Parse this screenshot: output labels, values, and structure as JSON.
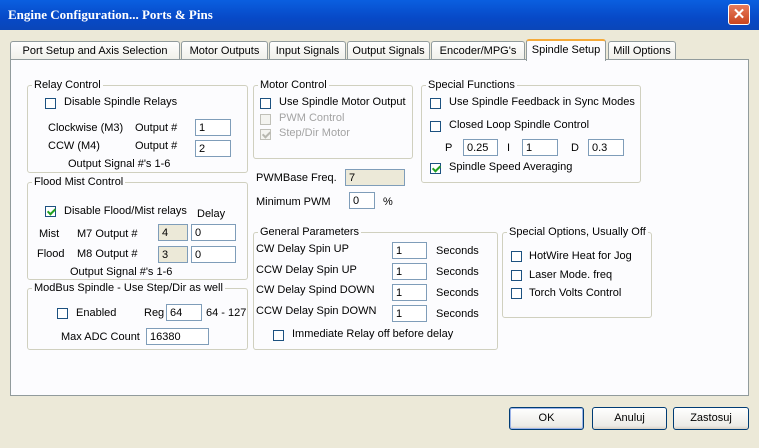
{
  "window": {
    "title": "Engine Configuration... Ports & Pins",
    "close": "✕"
  },
  "tabs": [
    {
      "label": "Port Setup and Axis Selection"
    },
    {
      "label": "Motor Outputs"
    },
    {
      "label": "Input Signals"
    },
    {
      "label": "Output Signals"
    },
    {
      "label": "Encoder/MPG's"
    },
    {
      "label": "Spindle Setup"
    },
    {
      "label": "Mill Options"
    }
  ],
  "relay": {
    "title": "Relay Control",
    "disable_label": "Disable Spindle Relays",
    "cw_label": "Clockwise (M3)",
    "ccw_label": "CCW (M4)",
    "output_label": "Output #",
    "cw_value": "1",
    "ccw_value": "2",
    "note": "Output Signal #'s 1-6"
  },
  "flood": {
    "title": "Flood Mist Control",
    "disable_label": "Disable Flood/Mist relays",
    "delay_label": "Delay",
    "mist_label": "Mist",
    "m7_label": "M7 Output #",
    "m7_value": "4",
    "mist_delay": "0",
    "flood_label": "Flood",
    "m8_label": "M8 Output #",
    "m8_value": "3",
    "flood_delay": "0",
    "note": "Output Signal #'s 1-6"
  },
  "modbus": {
    "title": "ModBus Spindle - Use Step/Dir as well",
    "enabled_label": "Enabled",
    "reg_label": "Reg",
    "reg_value": "64",
    "reg_range": "64 - 127",
    "max_adc_label": "Max ADC Count",
    "max_adc_value": "16380"
  },
  "motor": {
    "title": "Motor Control",
    "use_label": "Use Spindle Motor Output",
    "pwm_label": "PWM Control",
    "stepdir_label": "Step/Dir Motor",
    "pwmbase_label": "PWMBase Freq.",
    "pwmbase_value": "7",
    "minpwm_label": "Minimum PWM",
    "minpwm_value": "0",
    "minpwm_unit": "%"
  },
  "special": {
    "title": "Special Functions",
    "feedback_label": "Use Spindle Feedback in Sync Modes",
    "closed_label": "Closed Loop Spindle Control",
    "p_label": "P",
    "p_value": "0.25",
    "i_label": "I",
    "i_value": "1",
    "d_label": "D",
    "d_value": "0.3",
    "averaging_label": "Spindle Speed Averaging"
  },
  "general": {
    "title": "General Parameters",
    "rows": [
      {
        "label": "CW Delay Spin UP",
        "value": "1",
        "unit": "Seconds"
      },
      {
        "label": "CCW Delay Spin UP",
        "value": "1",
        "unit": "Seconds"
      },
      {
        "label": "CW Delay Spind DOWN",
        "value": "1",
        "unit": "Seconds"
      },
      {
        "label": "CCW Delay Spin DOWN",
        "value": "1",
        "unit": "Seconds"
      }
    ],
    "immediate_label": "Immediate Relay off before delay"
  },
  "options": {
    "title": "Special Options, Usually Off",
    "hotwire_label": "HotWire Heat for Jog",
    "laser_label": "Laser Mode. freq",
    "torch_label": "Torch Volts Control"
  },
  "buttons": {
    "ok": "OK",
    "cancel": "Anuluj",
    "apply": "Zastosuj"
  }
}
